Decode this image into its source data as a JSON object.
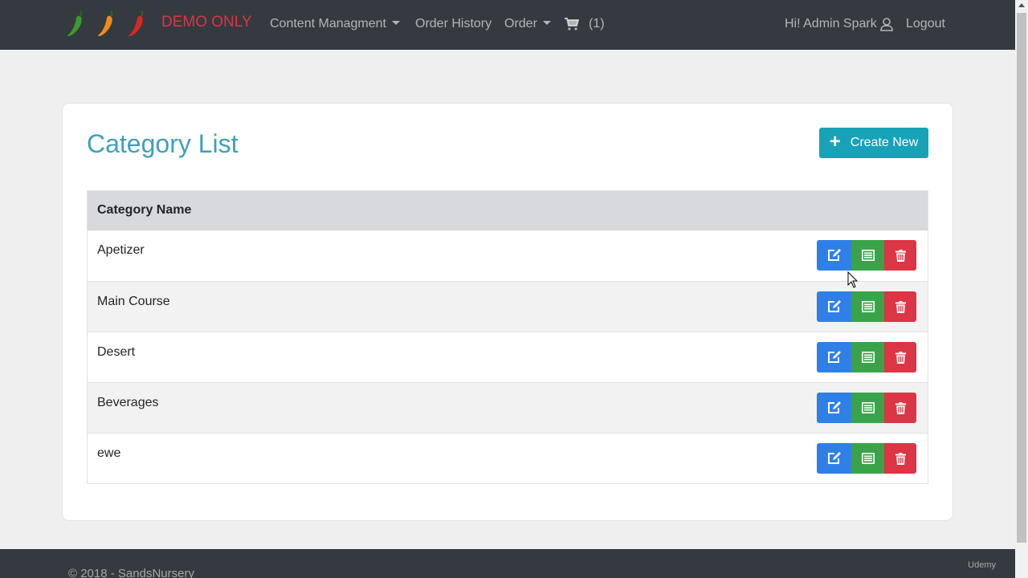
{
  "navbar": {
    "brand": "DEMO ONLY",
    "links": {
      "content_management": "Content Managment",
      "order_history": "Order History",
      "order": "Order"
    },
    "cart_count": "(1)",
    "user_greeting": "Hi! Admin Spark",
    "logout": "Logout",
    "logo_pepper_colors": [
      "#3a9a2a",
      "#f08a1c",
      "#d9281e"
    ]
  },
  "page": {
    "title": "Category List",
    "create_button": "Create New"
  },
  "table": {
    "header": "Category Name",
    "rows": [
      {
        "name": "Apetizer"
      },
      {
        "name": "Main Course"
      },
      {
        "name": "Desert"
      },
      {
        "name": "Beverages"
      },
      {
        "name": "ewe"
      }
    ]
  },
  "footer": {
    "text": "© 2018 - SandsNursery",
    "watermark": "Udemy"
  },
  "colors": {
    "edit": "#2f80e6",
    "details": "#3aa34a",
    "delete": "#dc3545",
    "primary_info": "#17a2b8",
    "title": "#3fa0ba"
  }
}
